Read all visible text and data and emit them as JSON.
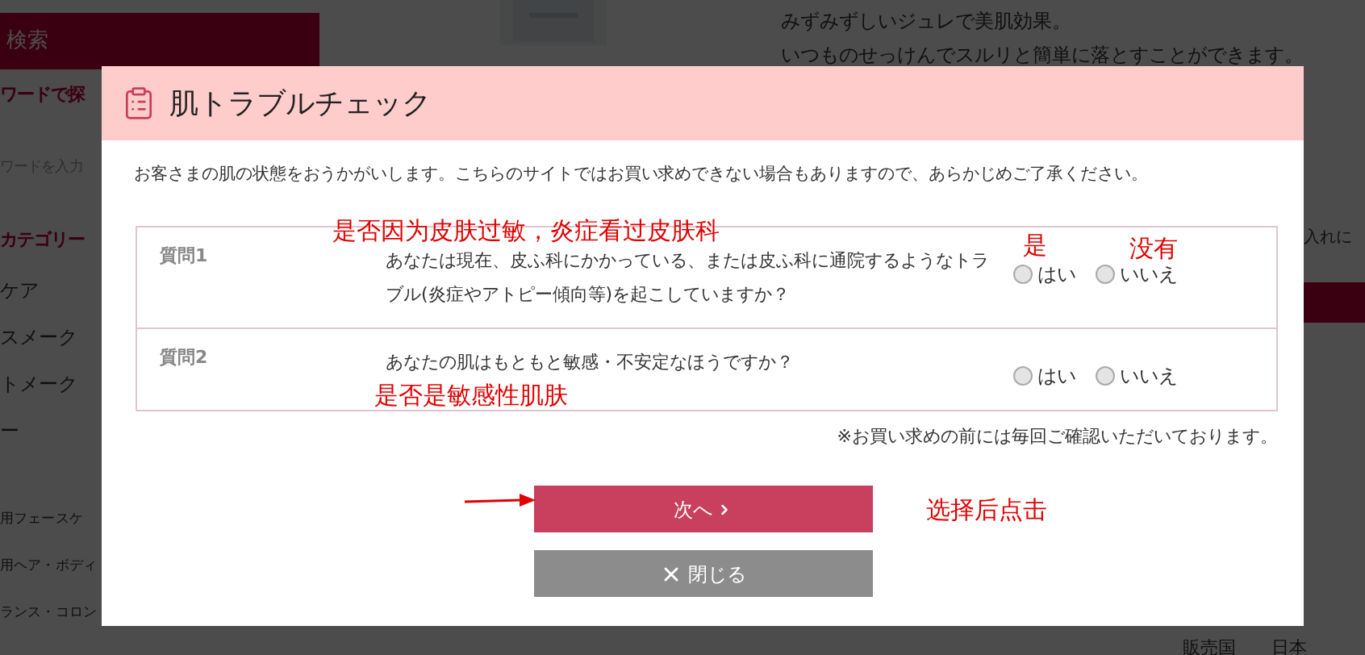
{
  "background_page": {
    "sidebar": {
      "search_title": "検索",
      "keyword_heading": "ワードで探",
      "keyword_placeholder": "ワードを入力",
      "category_heading": "カテゴリー",
      "categories": [
        "ケア",
        "スメーク",
        "トメーク",
        "ー"
      ],
      "more_categories": [
        "用フェースケ",
        "用ヘア・ボディ",
        "ランス・コロン"
      ]
    },
    "description": [
      "みずみずしいジュレで美肌効果。",
      "いつものせっけんでスルリと簡単に落とすことができます。"
    ],
    "side_button": "入れに",
    "origin_label": "販売国",
    "origin_value": "日本"
  },
  "dialog": {
    "title": "肌トラブルチェック",
    "intro": "お客さまの肌の状態をおうかがいします。こちらのサイトではお買い求めできない場合もありますので、あらかじめご了承ください。",
    "questions": [
      {
        "label": "質問1",
        "text": "あなたは現在、皮ふ科にかかっている、または皮ふ科に通院するようなトラブル(炎症やアトピー傾向等)を起こしていますか？",
        "options": [
          {
            "label": "はい",
            "selected": false
          },
          {
            "label": "いいえ",
            "selected": false
          }
        ]
      },
      {
        "label": "質問2",
        "text": "あなたの肌はもともと敏感・不安定なほうですか？",
        "options": [
          {
            "label": "はい",
            "selected": false
          },
          {
            "label": "いいえ",
            "selected": false
          }
        ]
      }
    ],
    "note": "※お買い求めの前には毎回ご確認いただいております。",
    "buttons": [
      {
        "kind": "primary",
        "label": "次へ"
      },
      {
        "kind": "close",
        "label": "閉じる"
      }
    ]
  },
  "annotations": [
    {
      "kind": "q1",
      "text": "是否因为皮肤过敏，炎症看过皮肤科"
    },
    {
      "kind": "yes",
      "text": "是"
    },
    {
      "kind": "no",
      "text": "没有"
    },
    {
      "kind": "q2",
      "text": "是否是敏感性肌肤"
    },
    {
      "kind": "click",
      "text": "选择后点击"
    }
  ]
}
